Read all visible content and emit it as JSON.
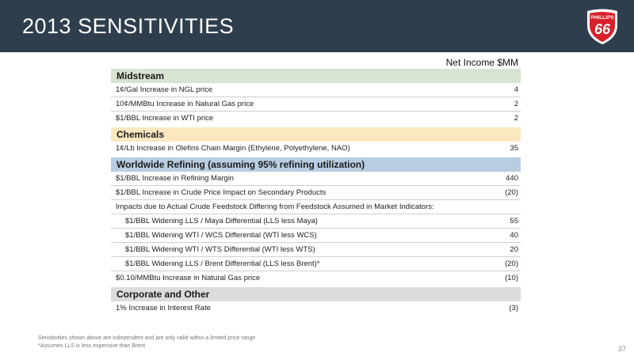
{
  "title": "2013 SENSITIVITIES",
  "logo": {
    "text": "PHILLIPS",
    "number": "66",
    "colors": {
      "red": "#d8202a",
      "white": "#ffffff"
    }
  },
  "column_header": "Net Income $MM",
  "sections": [
    {
      "name": "Midstream",
      "color": "#d9e4d0",
      "rows": [
        {
          "label": "1¢/Gal Increase in NGL price",
          "value": "4"
        },
        {
          "label": "10¢/MMBtu Increase in Natural Gas price",
          "value": "2"
        },
        {
          "label": "$1/BBL Increase in WTI price",
          "value": "2"
        }
      ]
    },
    {
      "name": "Chemicals",
      "color": "#fbe8c0",
      "rows": [
        {
          "label": "1¢/Lb Increase in Olefins Chain Margin (Ethylene, Polyethylene, NAO)",
          "value": "35"
        }
      ]
    },
    {
      "name": "Worldwide Refining (assuming 95% refining utilization)",
      "color": "#b9cde2",
      "rows": [
        {
          "label": "$1/BBL Increase in Refining Margin",
          "value": "440"
        },
        {
          "label": "$1/BBL Increase in Crude Price Impact on Secondary Products",
          "value": "(20)"
        },
        {
          "label": "Impacts due to Actual Crude Feedstock Differing from Feedstock Assumed in Market Indicators:",
          "value": ""
        },
        {
          "label": "$1/BBL Widening LLS / Maya Differential (LLS less Maya)",
          "value": "55",
          "indent": true
        },
        {
          "label": "$1/BBL Widening WTI / WCS Differential (WTI less WCS)",
          "value": "40",
          "indent": true
        },
        {
          "label": "$1/BBL Widening WTI / WTS Differential (WTI less WTS)",
          "value": "20",
          "indent": true
        },
        {
          "label": "$1/BBL Widening LLS / Brent Differential (LLS less Brent)*",
          "value": "(20)",
          "indent": true
        },
        {
          "label": "$0.10/MMBtu Increase in Natural Gas price",
          "value": "(10)"
        }
      ]
    },
    {
      "name": "Corporate and Other",
      "color": "#dcdcdc",
      "rows": [
        {
          "label": "1% Increase in Interest Rate",
          "value": "(3)"
        }
      ]
    }
  ],
  "footnotes": [
    "Sensitivities shown above are independent and are only valid within a limited price range",
    "*Assumes LLS is less expensive than Brent"
  ],
  "page_number": "37"
}
